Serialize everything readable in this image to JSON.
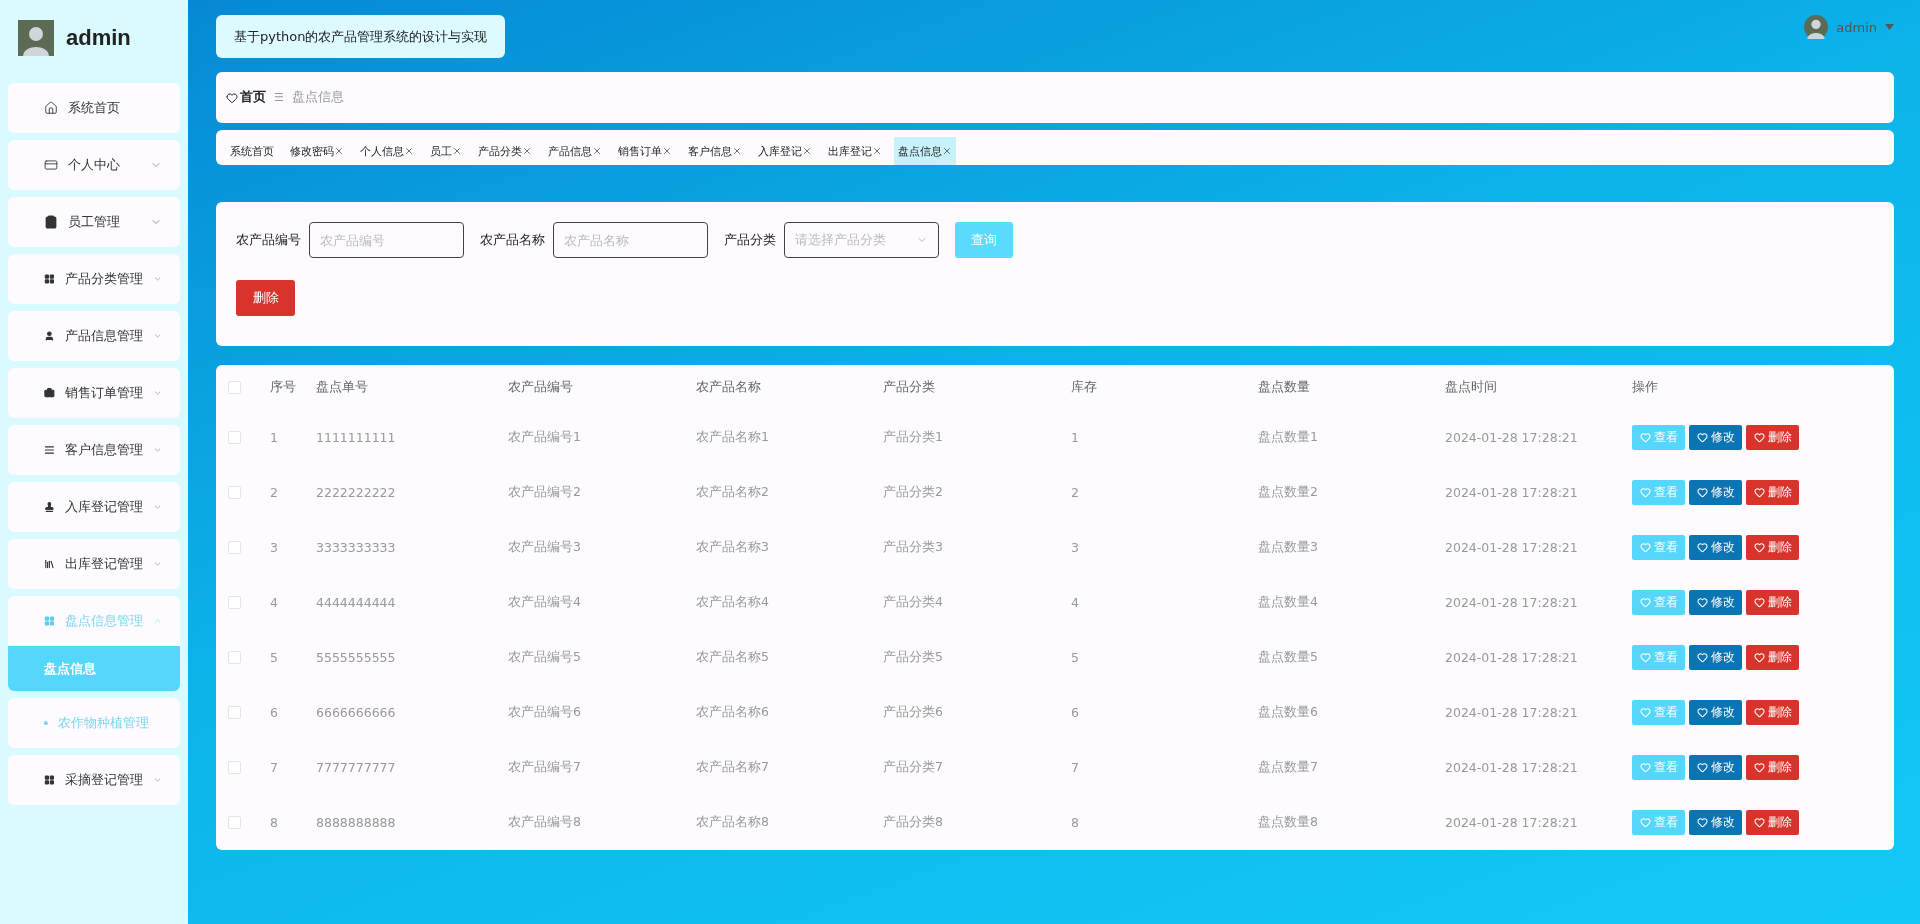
{
  "sidebar": {
    "user": "admin",
    "items": [
      {
        "label": "系统首页",
        "kind": "link",
        "hovered": false
      },
      {
        "label": "个人中心",
        "kind": "submenu",
        "expanded": false,
        "hovered": false
      },
      {
        "label": "员工管理",
        "kind": "submenu",
        "expanded": false,
        "hovered": false
      },
      {
        "label": "产品分类管理",
        "kind": "submenu",
        "expanded": false,
        "hovered": false
      },
      {
        "label": "产品信息管理",
        "kind": "submenu",
        "expanded": false,
        "hovered": false
      },
      {
        "label": "销售订单管理",
        "kind": "submenu",
        "expanded": false,
        "hovered": false
      },
      {
        "label": "客户信息管理",
        "kind": "submenu",
        "expanded": false,
        "hovered": false
      },
      {
        "label": "入库登记管理",
        "kind": "submenu",
        "expanded": false,
        "hovered": false
      },
      {
        "label": "出库登记管理",
        "kind": "submenu",
        "expanded": false,
        "hovered": false
      },
      {
        "label": "盘点信息管理",
        "kind": "submenu",
        "expanded": true,
        "hovered": false,
        "children": [
          {
            "label": "盘点信息",
            "selected": true
          }
        ]
      },
      {
        "label": "农作物种植管理",
        "kind": "submenu",
        "expanded": false,
        "hovered": true
      },
      {
        "label": "采摘登记管理",
        "kind": "submenu",
        "expanded": false,
        "hovered": false
      }
    ]
  },
  "header": {
    "title": "基于python的农产品管理系统的设计与实现",
    "user": "admin"
  },
  "breadcrumb": {
    "home": "首页",
    "separator": "☰",
    "current": "盘点信息"
  },
  "tabs": [
    {
      "label": "系统首页",
      "closable": false,
      "selected": false
    },
    {
      "label": "修改密码",
      "closable": true,
      "selected": false
    },
    {
      "label": "个人信息",
      "closable": true,
      "selected": false
    },
    {
      "label": "员工",
      "closable": true,
      "selected": false
    },
    {
      "label": "产品分类",
      "closable": true,
      "selected": false
    },
    {
      "label": "产品信息",
      "closable": true,
      "selected": false
    },
    {
      "label": "销售订单",
      "closable": true,
      "selected": false
    },
    {
      "label": "客户信息",
      "closable": true,
      "selected": false
    },
    {
      "label": "入库登记",
      "closable": true,
      "selected": false
    },
    {
      "label": "出库登记",
      "closable": true,
      "selected": false
    },
    {
      "label": "盘点信息",
      "closable": true,
      "selected": true
    }
  ],
  "filters": [
    {
      "label": "农产品编号",
      "kind": "input",
      "placeholder": "农产品编号"
    },
    {
      "label": "农产品名称",
      "kind": "input",
      "placeholder": "农产品名称"
    },
    {
      "label": "产品分类",
      "kind": "select",
      "placeholder": "请选择产品分类"
    }
  ],
  "search_button": "查询",
  "delete_button": "删除",
  "table": {
    "all_checked": false,
    "columns": [
      "序号",
      "盘点单号",
      "农产品编号",
      "农产品名称",
      "产品分类",
      "库存",
      "盘点数量",
      "盘点时间",
      "操作"
    ],
    "rows": [
      {
        "checked": false,
        "cells": [
          "1",
          "1111111111",
          "农产品编号1",
          "农产品名称1",
          "产品分类1",
          "1",
          "盘点数量1",
          "2024-01-28 17:28:21"
        ],
        "actions": [
          "查看",
          "修改",
          "删除"
        ]
      },
      {
        "checked": false,
        "cells": [
          "2",
          "2222222222",
          "农产品编号2",
          "农产品名称2",
          "产品分类2",
          "2",
          "盘点数量2",
          "2024-01-28 17:28:21"
        ],
        "actions": [
          "查看",
          "修改",
          "删除"
        ]
      },
      {
        "checked": false,
        "cells": [
          "3",
          "3333333333",
          "农产品编号3",
          "农产品名称3",
          "产品分类3",
          "3",
          "盘点数量3",
          "2024-01-28 17:28:21"
        ],
        "actions": [
          "查看",
          "修改",
          "删除"
        ]
      },
      {
        "checked": false,
        "cells": [
          "4",
          "4444444444",
          "农产品编号4",
          "农产品名称4",
          "产品分类4",
          "4",
          "盘点数量4",
          "2024-01-28 17:28:21"
        ],
        "actions": [
          "查看",
          "修改",
          "删除"
        ]
      },
      {
        "checked": false,
        "cells": [
          "5",
          "5555555555",
          "农产品编号5",
          "农产品名称5",
          "产品分类5",
          "5",
          "盘点数量5",
          "2024-01-28 17:28:21"
        ],
        "actions": [
          "查看",
          "修改",
          "删除"
        ]
      },
      {
        "checked": false,
        "cells": [
          "6",
          "6666666666",
          "农产品编号6",
          "农产品名称6",
          "产品分类6",
          "6",
          "盘点数量6",
          "2024-01-28 17:28:21"
        ],
        "actions": [
          "查看",
          "修改",
          "删除"
        ]
      },
      {
        "checked": false,
        "cells": [
          "7",
          "7777777777",
          "农产品编号7",
          "农产品名称7",
          "产品分类7",
          "7",
          "盘点数量7",
          "2024-01-28 17:28:21"
        ],
        "actions": [
          "查看",
          "修改",
          "删除"
        ]
      },
      {
        "checked": false,
        "cells": [
          "8",
          "8888888888",
          "农产品编号8",
          "农产品名称8",
          "产品分类8",
          "8",
          "盘点数量8",
          "2024-01-28 17:28:21"
        ],
        "actions": [
          "查看",
          "修改",
          "删除"
        ]
      }
    ]
  }
}
